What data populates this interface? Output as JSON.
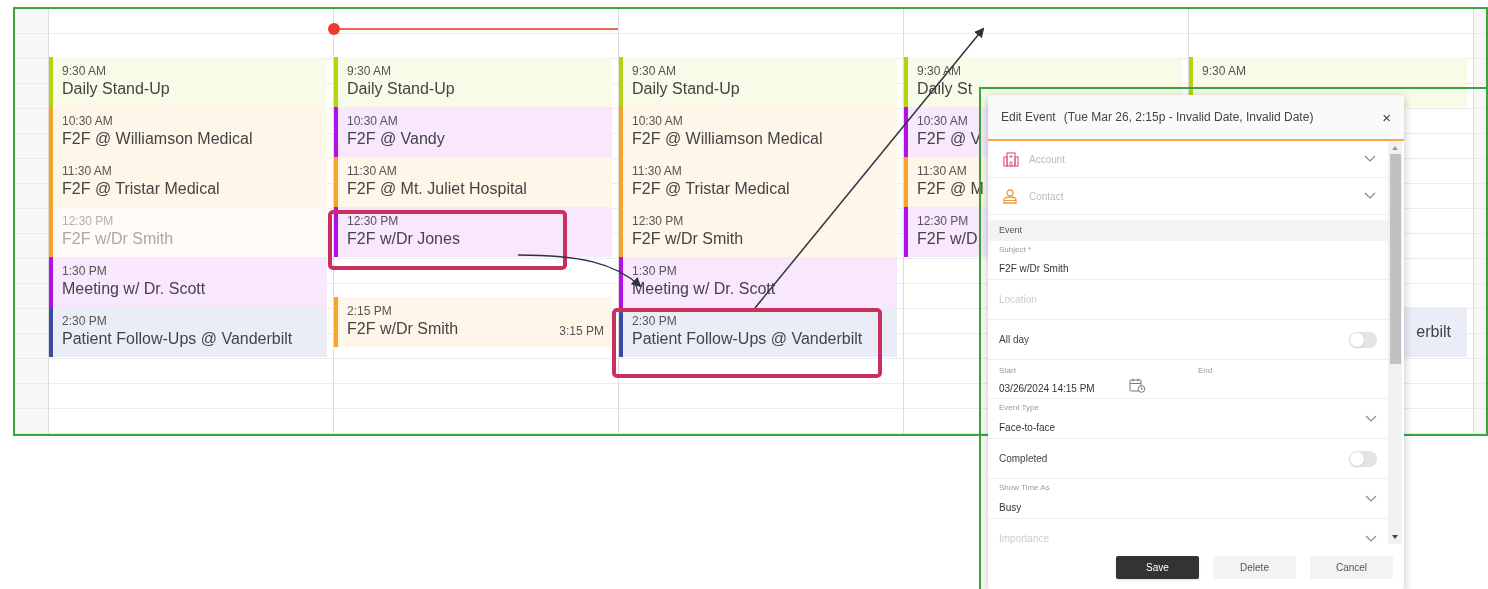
{
  "calendar": {
    "columns": [
      {
        "events": [
          {
            "time": "9:30 AM",
            "title": "Daily Stand-Up",
            "color": "#b5d40f",
            "faded": false
          },
          {
            "time": "10:30 AM",
            "title": "F2F @ Williamson Medical",
            "color": "#f7a325",
            "faded": false
          },
          {
            "time": "11:30 AM",
            "title": "F2F @ Tristar Medical",
            "color": "#f7a325",
            "faded": false
          },
          {
            "time": "12:30 PM",
            "title": "F2F w/Dr Smith",
            "color": "#f7a325",
            "faded": true
          },
          {
            "time": "1:30 PM",
            "title": "Meeting w/ Dr. Scott",
            "color": "#b40fe8",
            "faded": false
          },
          {
            "time": "2:30 PM",
            "title": "Patient Follow-Ups @ Vanderbilt",
            "color": "#3b4aa8",
            "faded": false
          }
        ]
      },
      {
        "now_line": true,
        "events": [
          {
            "time": "9:30 AM",
            "title": "Daily Stand-Up",
            "color": "#b5d40f",
            "faded": false
          },
          {
            "time": "10:30 AM",
            "title": "F2F @ Vandy",
            "color": "#b40fe8",
            "faded": false
          },
          {
            "time": "11:30 AM",
            "title": "F2F @ Mt. Juliet Hospital",
            "color": "#f7a325",
            "faded": false
          },
          {
            "time": "12:30 PM",
            "title": "F2F w/Dr Jones",
            "color": "#b40fe8",
            "faded": false
          },
          {
            "time": "2:15 PM",
            "title": "F2F w/Dr Smith",
            "end_time": "3:15 PM",
            "color": "#f7a325",
            "faded": false
          }
        ]
      },
      {
        "events": [
          {
            "time": "9:30 AM",
            "title": "Daily Stand-Up",
            "color": "#b5d40f",
            "faded": false
          },
          {
            "time": "10:30 AM",
            "title": "F2F @ Williamson Medical",
            "color": "#f7a325",
            "faded": false
          },
          {
            "time": "11:30 AM",
            "title": "F2F @ Tristar Medical",
            "color": "#f7a325",
            "faded": false
          },
          {
            "time": "12:30 PM",
            "title": "F2F w/Dr Smith",
            "color": "#f7a325",
            "faded": false
          },
          {
            "time": "1:30 PM",
            "title": "Meeting w/ Dr. Scott",
            "color": "#b40fe8",
            "faded": false
          },
          {
            "time": "2:30 PM",
            "title": "Patient Follow-Ups @ Vanderbilt",
            "color": "#3b4aa8",
            "faded": false
          }
        ]
      },
      {
        "events": [
          {
            "time": "9:30 AM",
            "title": "Daily St",
            "color": "#b5d40f",
            "faded": false
          },
          {
            "time": "10:30 AM",
            "title": "F2F @ V",
            "color": "#b40fe8",
            "faded": false
          },
          {
            "time": "11:30 AM",
            "title": "F2F @ M",
            "color": "#f7a325",
            "faded": false
          },
          {
            "time": "12:30 PM",
            "title": "F2F w/D",
            "color": "#b40fe8",
            "faded": false
          }
        ]
      },
      {
        "events": [
          {
            "time": "9:30 AM",
            "color": "#b5d40f",
            "faded": false
          },
          {
            "title": "erbilt",
            "kind": "partial"
          }
        ]
      }
    ]
  },
  "dialog": {
    "title": "Edit Event",
    "subtitle": "(Tue Mar 26, 2:15p - Invalid Date, Invalid Date)",
    "close": "×",
    "fields": [
      {
        "kind": "lookup",
        "placeholder": "Account"
      },
      {
        "kind": "lookup",
        "placeholder": "Contact"
      },
      {
        "kind": "section",
        "label": "Event"
      },
      {
        "kind": "text",
        "label": "Subject *",
        "value": "F2F w/Dr Smith"
      },
      {
        "kind": "text",
        "placeholder": "Location"
      },
      {
        "kind": "toggle",
        "label": "All day",
        "on": false
      },
      {
        "kind": "datetime",
        "start_label": "Start",
        "start_value": "03/26/2024 14:15 PM",
        "end_label": "End"
      },
      {
        "kind": "select",
        "label": "Event Type",
        "value": "Face-to-face"
      },
      {
        "kind": "toggle",
        "label": "Completed",
        "on": false
      },
      {
        "kind": "select",
        "label": "Show Time As",
        "value": "Busy"
      },
      {
        "kind": "select",
        "placeholder": "Importance"
      }
    ],
    "buttons": [
      {
        "label": "Save",
        "primary": true
      },
      {
        "label": "Delete",
        "primary": false
      },
      {
        "label": "Cancel",
        "primary": false
      }
    ]
  }
}
